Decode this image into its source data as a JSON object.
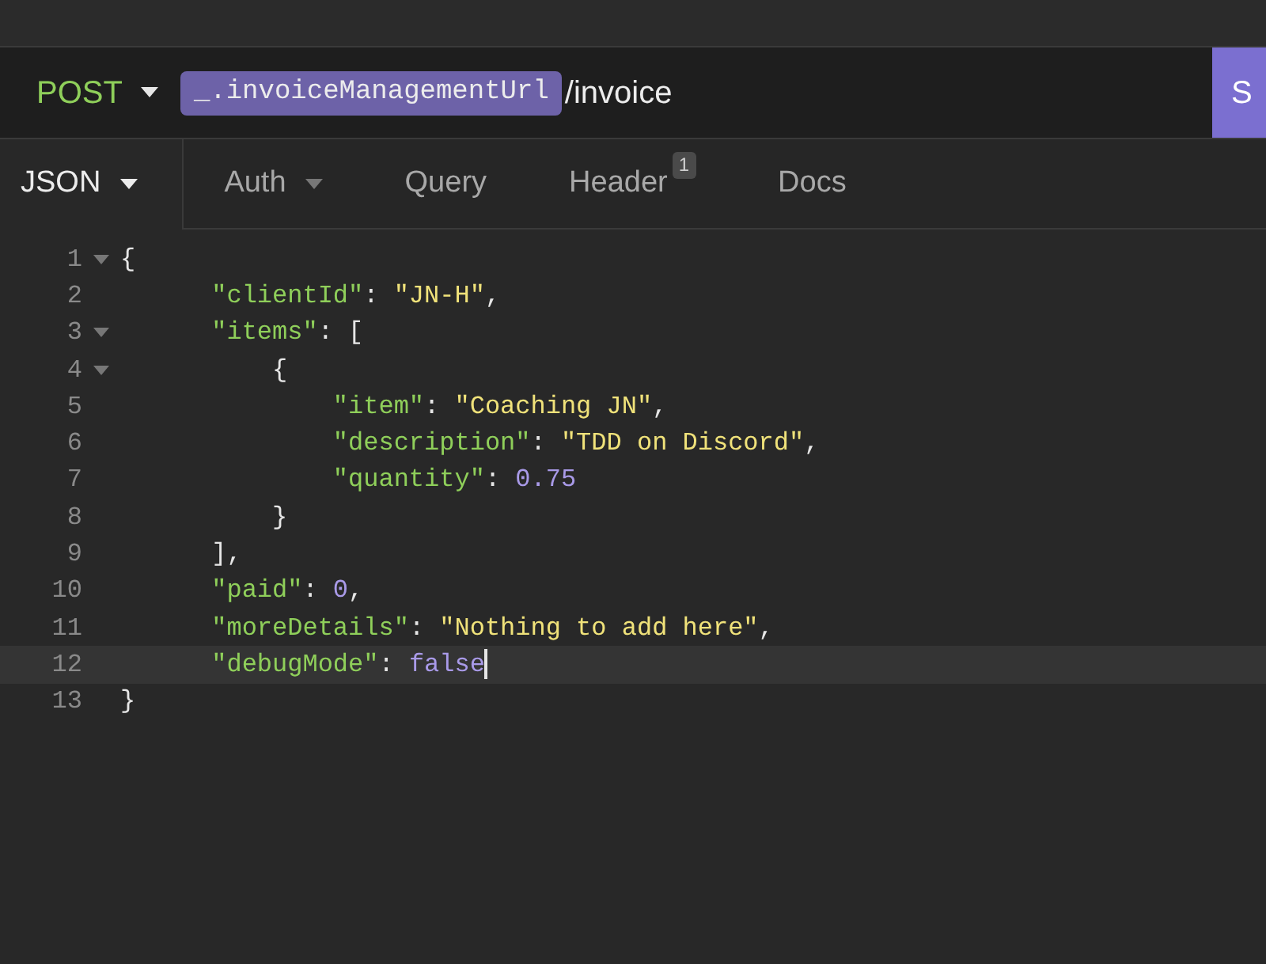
{
  "request": {
    "method": "POST",
    "url_variable": "_.invoiceManagementUrl",
    "url_path": "/invoice",
    "send_label": "S"
  },
  "tabs": [
    {
      "label": "JSON",
      "selected": true,
      "dropdown": true
    },
    {
      "label": "Auth",
      "selected": false,
      "dropdown": true
    },
    {
      "label": "Query",
      "selected": false,
      "dropdown": false
    },
    {
      "label": "Header",
      "selected": false,
      "dropdown": false,
      "badge": "1"
    },
    {
      "label": "Docs",
      "selected": false,
      "dropdown": false
    }
  ],
  "editor": {
    "lines": [
      {
        "number": "1",
        "foldable": true,
        "active": false,
        "tokens": [
          {
            "kind": "punct",
            "text": "{"
          }
        ]
      },
      {
        "number": "2",
        "foldable": false,
        "active": false,
        "tokens": [
          {
            "kind": "key",
            "text": "      \"clientId\""
          },
          {
            "kind": "punct",
            "text": ": "
          },
          {
            "kind": "string",
            "text": "\"JN-H\""
          },
          {
            "kind": "punct",
            "text": ","
          }
        ]
      },
      {
        "number": "3",
        "foldable": true,
        "active": false,
        "tokens": [
          {
            "kind": "key",
            "text": "      \"items\""
          },
          {
            "kind": "punct",
            "text": ": ["
          }
        ]
      },
      {
        "number": "4",
        "foldable": true,
        "active": false,
        "tokens": [
          {
            "kind": "punct",
            "text": "          {"
          }
        ]
      },
      {
        "number": "5",
        "foldable": false,
        "active": false,
        "tokens": [
          {
            "kind": "key",
            "text": "              \"item\""
          },
          {
            "kind": "punct",
            "text": ": "
          },
          {
            "kind": "string",
            "text": "\"Coaching JN\""
          },
          {
            "kind": "punct",
            "text": ","
          }
        ]
      },
      {
        "number": "6",
        "foldable": false,
        "active": false,
        "tokens": [
          {
            "kind": "key",
            "text": "              \"description\""
          },
          {
            "kind": "punct",
            "text": ": "
          },
          {
            "kind": "string",
            "text": "\"TDD on Discord\""
          },
          {
            "kind": "punct",
            "text": ","
          }
        ]
      },
      {
        "number": "7",
        "foldable": false,
        "active": false,
        "tokens": [
          {
            "kind": "key",
            "text": "              \"quantity\""
          },
          {
            "kind": "punct",
            "text": ": "
          },
          {
            "kind": "number",
            "text": "0.75"
          }
        ]
      },
      {
        "number": "8",
        "foldable": false,
        "active": false,
        "tokens": [
          {
            "kind": "punct",
            "text": "          }"
          }
        ]
      },
      {
        "number": "9",
        "foldable": false,
        "active": false,
        "tokens": [
          {
            "kind": "punct",
            "text": "      ],"
          }
        ]
      },
      {
        "number": "10",
        "foldable": false,
        "active": false,
        "tokens": [
          {
            "kind": "key",
            "text": "      \"paid\""
          },
          {
            "kind": "punct",
            "text": ": "
          },
          {
            "kind": "number",
            "text": "0"
          },
          {
            "kind": "punct",
            "text": ","
          }
        ]
      },
      {
        "number": "11",
        "foldable": false,
        "active": false,
        "tokens": [
          {
            "kind": "key",
            "text": "      \"moreDetails\""
          },
          {
            "kind": "punct",
            "text": ": "
          },
          {
            "kind": "string",
            "text": "\"Nothing to add here\""
          },
          {
            "kind": "punct",
            "text": ","
          }
        ]
      },
      {
        "number": "12",
        "foldable": false,
        "active": true,
        "tokens": [
          {
            "kind": "key",
            "text": "      \"debugMode\""
          },
          {
            "kind": "punct",
            "text": ": "
          },
          {
            "kind": "number",
            "text": "false"
          }
        ]
      },
      {
        "number": "13",
        "foldable": false,
        "active": false,
        "tokens": [
          {
            "kind": "punct",
            "text": "}"
          }
        ]
      }
    ]
  }
}
